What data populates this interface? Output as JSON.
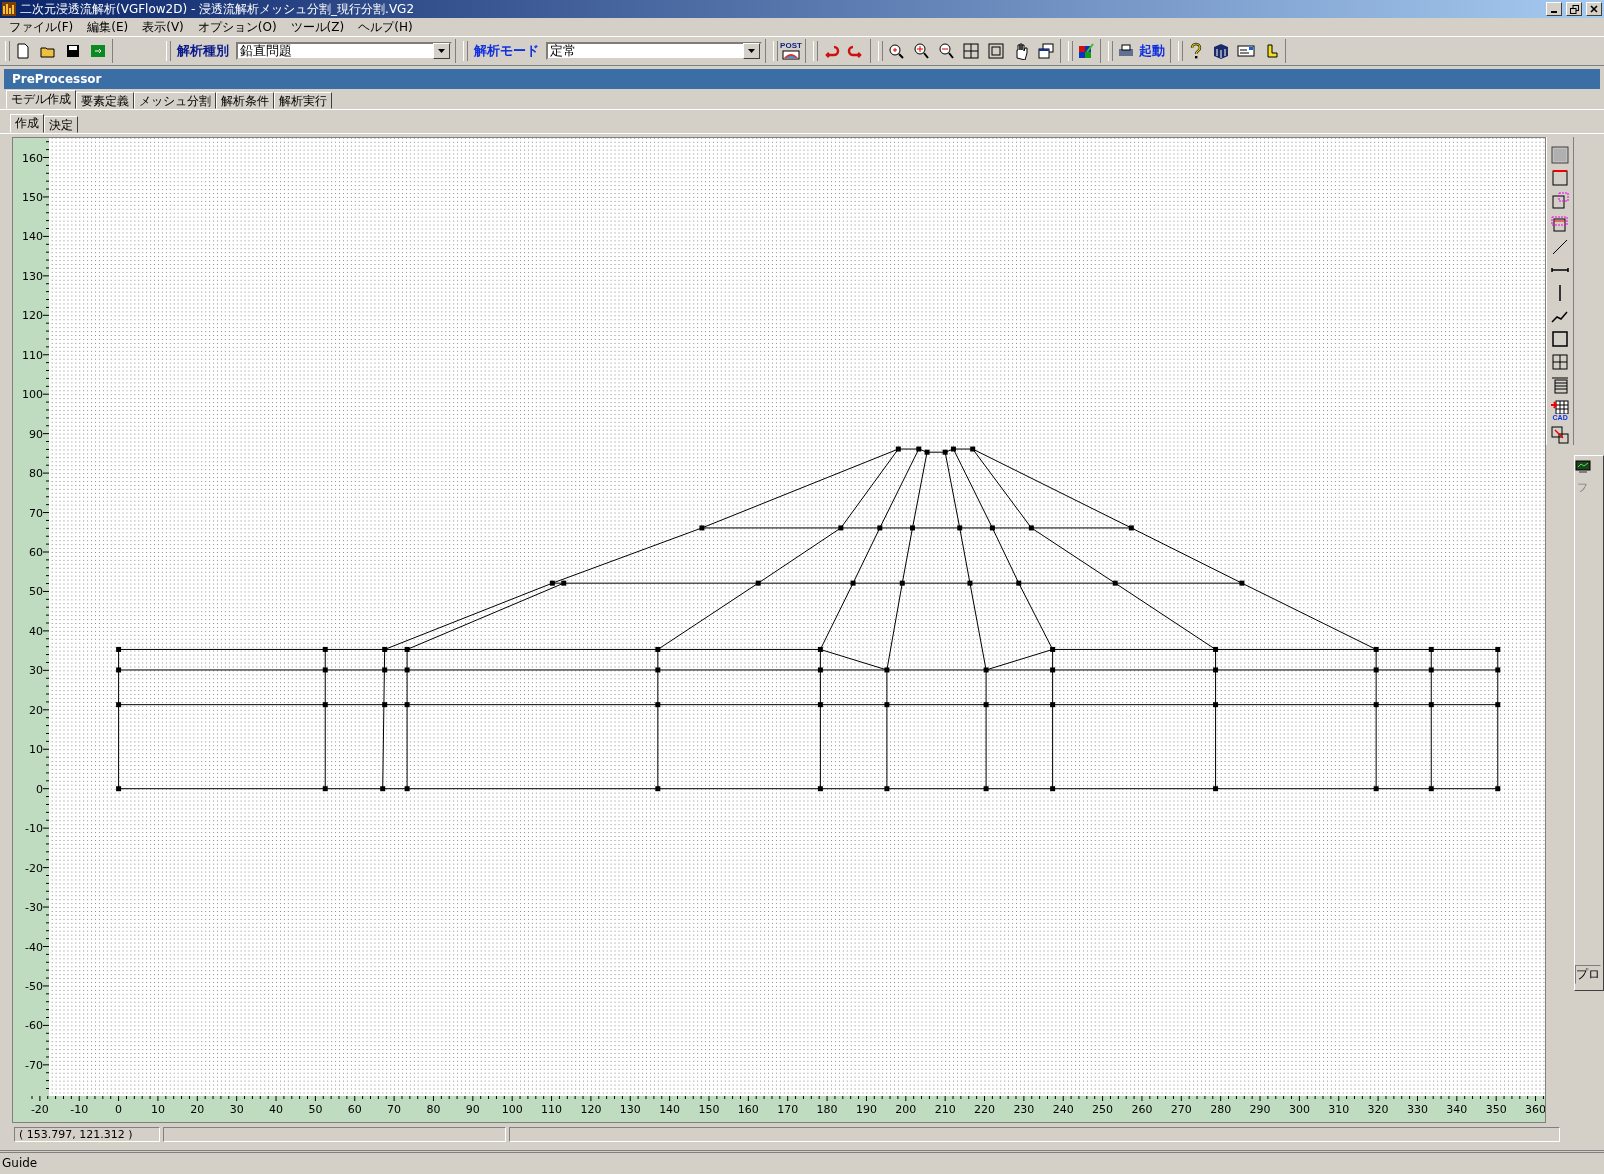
{
  "window": {
    "title": "二次元浸透流解析(VGFlow2D) - 浸透流解析メッシュ分割_現行分割.VG2"
  },
  "menu": [
    "ファイル(F)",
    "編集(E)",
    "表示(V)",
    "オプション(O)",
    "ツール(Z)",
    "ヘルプ(H)"
  ],
  "toolbar": {
    "type_label": "解析種別",
    "type_value": "鉛直問題",
    "mode_label": "解析モード",
    "mode_value": "定常",
    "post_label": "POST",
    "run_label": "起動"
  },
  "panel": {
    "title": "PreProcessor"
  },
  "tabs": [
    {
      "label": "モデル作成",
      "selected": true
    },
    {
      "label": "要素定義",
      "selected": false
    },
    {
      "label": "メッシュ分割",
      "selected": false
    },
    {
      "label": "解析条件",
      "selected": false
    },
    {
      "label": "解析実行",
      "selected": false
    }
  ],
  "subtabs": [
    {
      "label": "作成",
      "selected": true
    },
    {
      "label": "決定",
      "selected": false
    }
  ],
  "canvas": {
    "y_labels": [
      "160",
      "150",
      "140",
      "130",
      "120",
      "110",
      "100",
      "90",
      "80",
      "70",
      "60",
      "50",
      "40",
      "30",
      "20",
      "10",
      "0",
      "-10",
      "-20",
      "-30",
      "-40",
      "-50",
      "-60",
      "-70"
    ],
    "x_labels": [
      "-20",
      "-10",
      "0",
      "10",
      "20",
      "30",
      "40",
      "50",
      "60",
      "70",
      "80",
      "90",
      "100",
      "110",
      "120",
      "130",
      "140",
      "150",
      "160",
      "170",
      "180",
      "190",
      "200",
      "210",
      "220",
      "230",
      "240",
      "250",
      "260",
      "270",
      "280",
      "290",
      "300",
      "310",
      "320",
      "330",
      "340",
      "350",
      "360"
    ]
  },
  "side_tools": {
    "cad_label": "CAD"
  },
  "side_panel": {
    "tab": "フ",
    "field": "プロ"
  },
  "status_bar": {
    "coordinates": "( 153.797,  121.312 )"
  },
  "guide": "Guide"
}
